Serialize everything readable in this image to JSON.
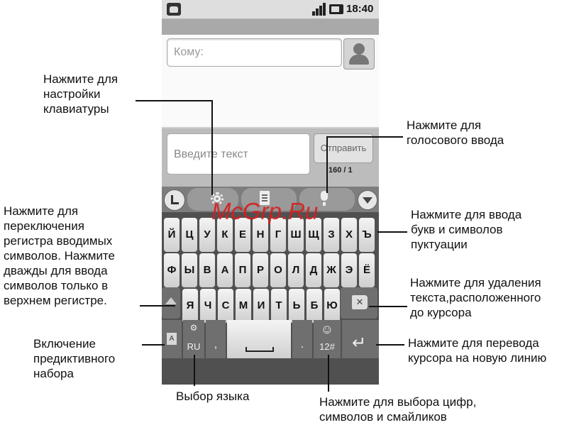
{
  "status_bar": {
    "time": "18:40"
  },
  "compose": {
    "to_placeholder": "Кому:",
    "message_placeholder": "Введите текст",
    "send_label": "Отправить",
    "char_counter": "160 / 1"
  },
  "keyboard": {
    "row1": [
      "Й",
      "Ц",
      "У",
      "К",
      "Е",
      "Н",
      "Г",
      "Ш",
      "Щ",
      "З",
      "Х",
      "Ъ"
    ],
    "row2": [
      "Ф",
      "Ы",
      "В",
      "А",
      "П",
      "Р",
      "О",
      "Л",
      "Д",
      "Ж",
      "Э",
      "Ё"
    ],
    "row3": [
      "Я",
      "Ч",
      "С",
      "М",
      "И",
      "Т",
      "Ь",
      "Б",
      "Ю"
    ],
    "comma": ",",
    "period": ".",
    "language_code": "RU",
    "symbols_label": "12#"
  },
  "annotations": {
    "settings": [
      "Нажмите для",
      "настройки",
      "клавиатуры"
    ],
    "voice": [
      "Нажмите для",
      "голосового ввода"
    ],
    "shift": [
      "Нажмите для",
      "переключения",
      "регистра вводимых",
      "символов. Нажмите",
      "дважды для ввода",
      "символов только в",
      "верхнем регистре."
    ],
    "letters": [
      "Нажмите для ввода",
      "букв и символов",
      "пуктуации"
    ],
    "delete": [
      "Нажмите для удаления",
      "текста,расположенного",
      "до курсора"
    ],
    "predictive": [
      "Включение",
      "предиктивного",
      "набора"
    ],
    "newline": [
      "Нажмите для перевода",
      "курсора на новую линию"
    ],
    "language": "Выбор языка",
    "symbols": [
      "Нажмите для выбора цифр,",
      "символов и смайликов"
    ]
  },
  "watermark": "McGrp.Ru",
  "icons": [
    "android-icon",
    "signal-icon",
    "battery-icon",
    "contact-icon",
    "gear-icon",
    "document-icon",
    "microphone-icon",
    "hide-keyboard-icon",
    "shift-icon",
    "delete-icon",
    "enter-icon",
    "smiley-icon"
  ]
}
